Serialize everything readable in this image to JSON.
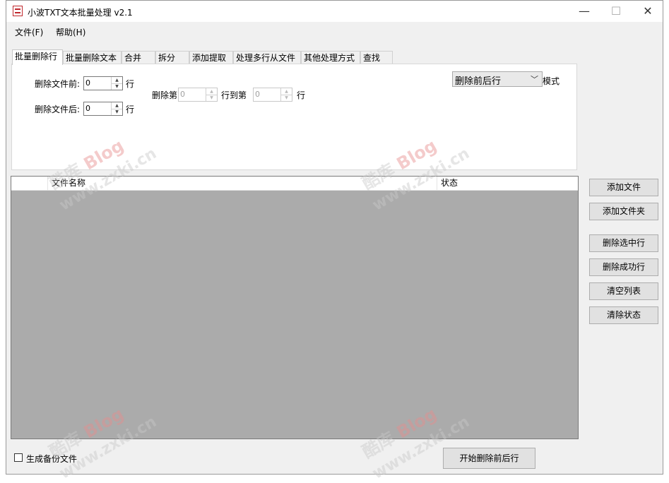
{
  "window": {
    "title": "小波TXT文本批量处理 v2.1",
    "controls": {
      "minimize": "—",
      "maximize": "☐",
      "close": "✕"
    }
  },
  "menu": {
    "file": "文件(F)",
    "help": "帮助(H)"
  },
  "tabs": [
    {
      "label": "批量删除行",
      "active": true
    },
    {
      "label": "批量删除文本",
      "active": false
    },
    {
      "label": "合并",
      "active": false
    },
    {
      "label": "拆分",
      "active": false
    },
    {
      "label": "添加提取",
      "active": false
    },
    {
      "label": "处理多行从文件",
      "active": false
    },
    {
      "label": "其他处理方式",
      "active": false
    },
    {
      "label": "查找",
      "active": false
    }
  ],
  "panel": {
    "delete_before_label": "删除文件前:",
    "delete_before_value": "0",
    "delete_before_unit": "行",
    "delete_after_label": "删除文件后:",
    "delete_after_value": "0",
    "delete_after_unit": "行",
    "delete_from_label": "删除第",
    "delete_from_value": "0",
    "delete_to_label": "行到第",
    "delete_to_value": "0",
    "delete_to_unit": "行",
    "mode_value": "删除前后行",
    "mode_label": "模式"
  },
  "list": {
    "columns": [
      "",
      "文件名称",
      "状态"
    ],
    "rows": []
  },
  "side_buttons": {
    "add_file": "添加文件",
    "add_folder": "添加文件夹",
    "delete_selected": "删除选中行",
    "delete_success": "删除成功行",
    "clear_list": "清空列表",
    "clear_status": "清除状态"
  },
  "footer": {
    "backup_checkbox_label": "生成备份文件",
    "backup_checked": false,
    "start_button": "开始删除前后行"
  },
  "watermark": {
    "line1_prefix": "酷库",
    "line1_blog": "Blog",
    "line2": "www.zxki.cn"
  }
}
